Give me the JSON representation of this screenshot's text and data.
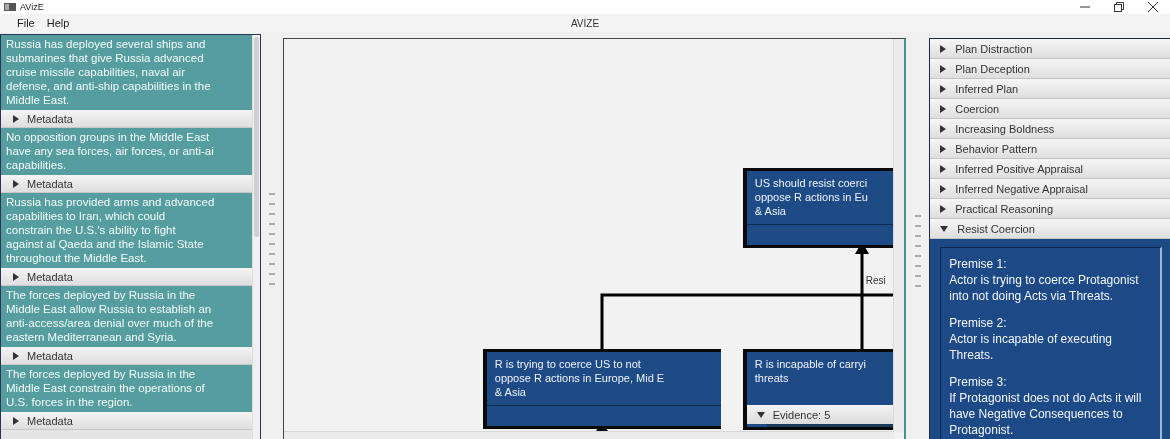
{
  "window": {
    "title": "AVizE"
  },
  "menu": [
    "File",
    "Help"
  ],
  "app_title": "AVIZE",
  "evidence": [
    {
      "lines": [
        "Russia has deployed several ships and",
        "submarines that give Russia advanced",
        "cruise missile capabilities, naval air",
        "defense, and anti-ship capabilities in the",
        "Middle East."
      ],
      "metadata": {
        "label": "Metadata",
        "expanded": false
      }
    },
    {
      "lines": [
        "No opposition groups in the Middle East",
        "have any sea forces, air forces, or anti-ai",
        "capabilities."
      ],
      "metadata": {
        "label": "Metadata",
        "expanded": false
      }
    },
    {
      "lines": [
        "Russia has provided arms and advanced",
        "capabilities to Iran, which could",
        "constrain the U.S.'s ability to fight",
        "against al Qaeda and the Islamic State",
        "throughout the Middle East."
      ],
      "metadata": {
        "label": "Metadata",
        "expanded": false
      }
    },
    {
      "lines": [
        "The forces deployed by Russia in the",
        "Middle East allow Russia to establish an",
        "anti-access/area denial over much of the",
        "eastern Mediterranean and Syria."
      ],
      "metadata": {
        "label": "Metadata",
        "expanded": false
      }
    },
    {
      "lines": [
        "The forces deployed by Russia in the",
        "Middle East constrain the operations of",
        "U.S. forces in the region."
      ],
      "metadata": {
        "label": "Metadata",
        "expanded": false
      }
    }
  ],
  "graph": {
    "nodes": [
      {
        "lines": [
          "US should resist coerci",
          "oppose R actions in Eu",
          "& Asia"
        ]
      },
      {
        "lines": [
          "R is trying to coerce US to not",
          "oppose R actions in Europe, Mid E",
          "& Asia"
        ]
      },
      {
        "lines": [
          "R is incapable of carryi",
          "threats"
        ],
        "evidence": {
          "label": "Evidence: 5",
          "expanded": true
        }
      }
    ],
    "edge_label": "Resi"
  },
  "schemes": [
    {
      "label": "Plan Distraction",
      "expanded": false
    },
    {
      "label": "Plan Deception",
      "expanded": false
    },
    {
      "label": "Inferred Plan",
      "expanded": false
    },
    {
      "label": "Coercion",
      "expanded": false
    },
    {
      "label": "Increasing Boldness",
      "expanded": false
    },
    {
      "label": "Behavior Pattern",
      "expanded": false
    },
    {
      "label": "Inferred Positive Appraisal",
      "expanded": false
    },
    {
      "label": "Inferred Negative Appraisal",
      "expanded": false
    },
    {
      "label": "Practical Reasoning",
      "expanded": false
    },
    {
      "label": "Resist Coercion",
      "expanded": true,
      "premises": [
        {
          "heading": "Premise 1:",
          "text": "Actor is trying to coerce Protagonist into not doing Acts via Threats."
        },
        {
          "heading": "Premise 2:",
          "text": "Actor is incapable of executing Threats."
        },
        {
          "heading": "Premise 3:",
          "text": "If Protagonist does not do Acts it will have Negative Consequences to Protagonist."
        }
      ]
    }
  ]
}
